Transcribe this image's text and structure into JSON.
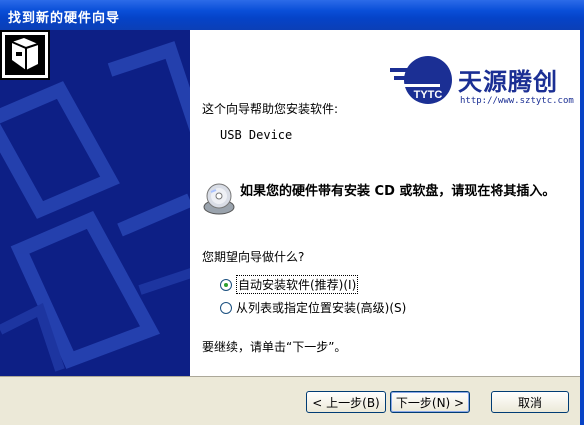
{
  "window": {
    "title": "找到新的硬件向导"
  },
  "logo": {
    "tag": "TYTC",
    "name": "天源腾创",
    "url": "http://www.sztytc.com"
  },
  "content": {
    "intro": "这个向导帮助您安装软件:",
    "device": "USB Device",
    "prompt": "如果您的硬件带有安装 CD 或软盘，请现在将其插入。",
    "question": "您期望向导做什么?",
    "options": [
      {
        "label": "自动安装软件(推荐)(I)",
        "selected": true
      },
      {
        "label": "从列表或指定位置安装(高级)(S)",
        "selected": false
      }
    ],
    "continue": "要继续，请单击“下一步”。"
  },
  "buttons": {
    "back": "< 上一步(B)",
    "next": "下一步(N) >",
    "cancel": "取消"
  },
  "colors": {
    "banner": "#0d1f85",
    "titlebar": "#0a4fd8",
    "buttonbar": "#ece9d8",
    "logo": "#1b2f94"
  },
  "icons": {
    "header": "hardware-device-icon",
    "media": "cd-disk-icon"
  }
}
